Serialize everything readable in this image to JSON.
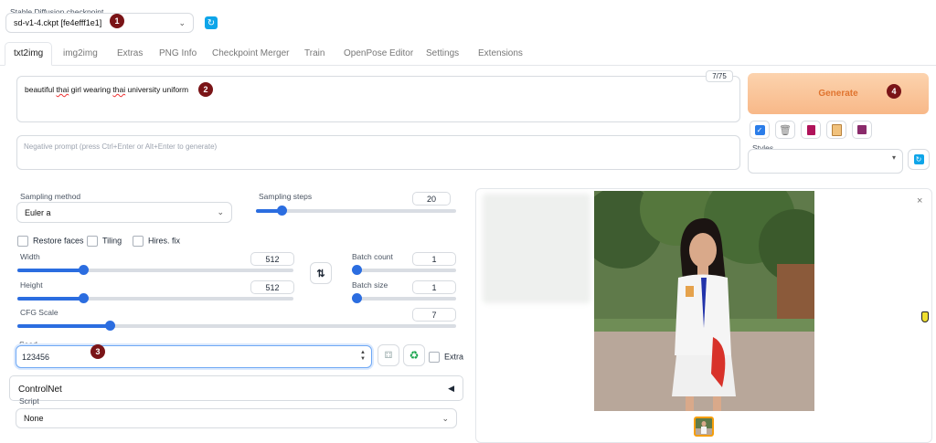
{
  "checkpoint": {
    "label": "Stable Diffusion checkpoint",
    "value": "sd-v1-4.ckpt [fe4efff1e1]"
  },
  "tabs": [
    "txt2img",
    "img2img",
    "Extras",
    "PNG Info",
    "Checkpoint Merger",
    "Train",
    "OpenPose Editor",
    "Settings",
    "Extensions"
  ],
  "prompt": {
    "text_pre": "beautiful ",
    "word1": "thai",
    "text_mid": " girl wearing ",
    "word2": "thai",
    "text_post": " university uniform",
    "token_count": "7/75",
    "negative_placeholder": "Negative prompt (press Ctrl+Enter or Alt+Enter to generate)"
  },
  "generate_label": "Generate",
  "styles_label": "Styles",
  "markers": [
    "1",
    "2",
    "3",
    "4"
  ],
  "sampling": {
    "method_label": "Sampling method",
    "method_value": "Euler a",
    "steps_label": "Sampling steps",
    "steps": "20",
    "steps_fraction": 0.13
  },
  "checkboxes": [
    "Restore faces",
    "Tiling",
    "Hires. fix"
  ],
  "width": {
    "label": "Width",
    "value": "512",
    "fraction": 0.24
  },
  "height": {
    "label": "Height",
    "value": "512",
    "fraction": 0.24
  },
  "batch_count": {
    "label": "Batch count",
    "value": "1",
    "fraction": 0.0
  },
  "batch_size": {
    "label": "Batch size",
    "value": "1",
    "fraction": 0.0
  },
  "cfg": {
    "label": "CFG Scale",
    "value": "7",
    "fraction": 0.21
  },
  "seed": {
    "label": "Seed",
    "value": "123456",
    "extra_label": "Extra"
  },
  "controlnet_label": "ControlNet",
  "script": {
    "label": "Script",
    "value": "None"
  },
  "colors": {
    "accent": "#2b6de0",
    "generate_bg": "#fbcba0",
    "generate_text": "#e0742f",
    "marker": "#7a1417"
  },
  "icons": {
    "refresh": "refresh-icon",
    "swap": "swap-icon",
    "dice": "dice-icon",
    "recycle": "recycle-icon",
    "close": "close-icon"
  }
}
